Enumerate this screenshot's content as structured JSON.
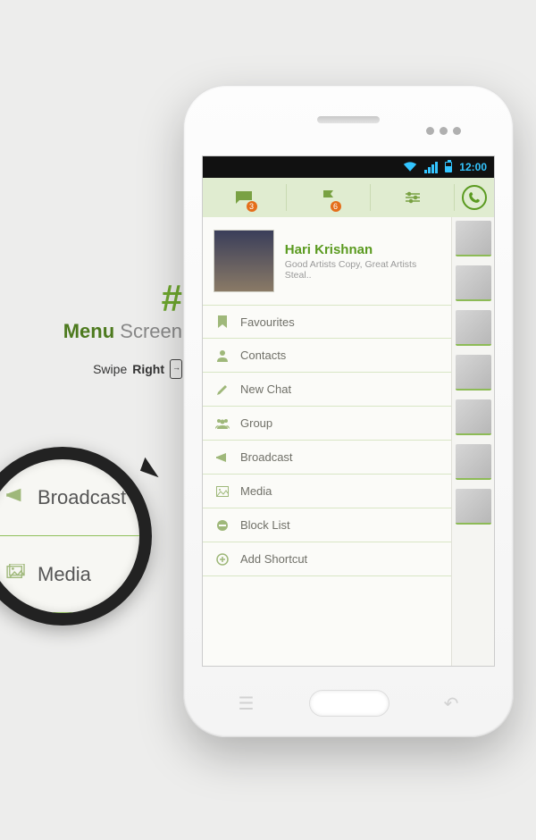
{
  "description": {
    "hash": "#",
    "title_bold": "Menu",
    "title_light": "Screen",
    "swipe_pre": "Swipe",
    "swipe_bold": "Right"
  },
  "magnifier": {
    "item1": "Broadcast",
    "item2": "Media"
  },
  "statusbar": {
    "time": "12:00"
  },
  "tabbar": {
    "chats_badge": "3",
    "flags_badge": "6"
  },
  "profile": {
    "name": "Hari Krishnan",
    "status": "Good Artists Copy, Great Artists Steal.."
  },
  "menu": {
    "items": [
      {
        "icon": "bookmark",
        "label": "Favourites"
      },
      {
        "icon": "person",
        "label": "Contacts"
      },
      {
        "icon": "pencil",
        "label": "New Chat"
      },
      {
        "icon": "group",
        "label": "Group"
      },
      {
        "icon": "megaphone",
        "label": "Broadcast"
      },
      {
        "icon": "image",
        "label": "Media"
      },
      {
        "icon": "block",
        "label": "Block List"
      },
      {
        "icon": "plus",
        "label": "Add Shortcut"
      }
    ]
  }
}
